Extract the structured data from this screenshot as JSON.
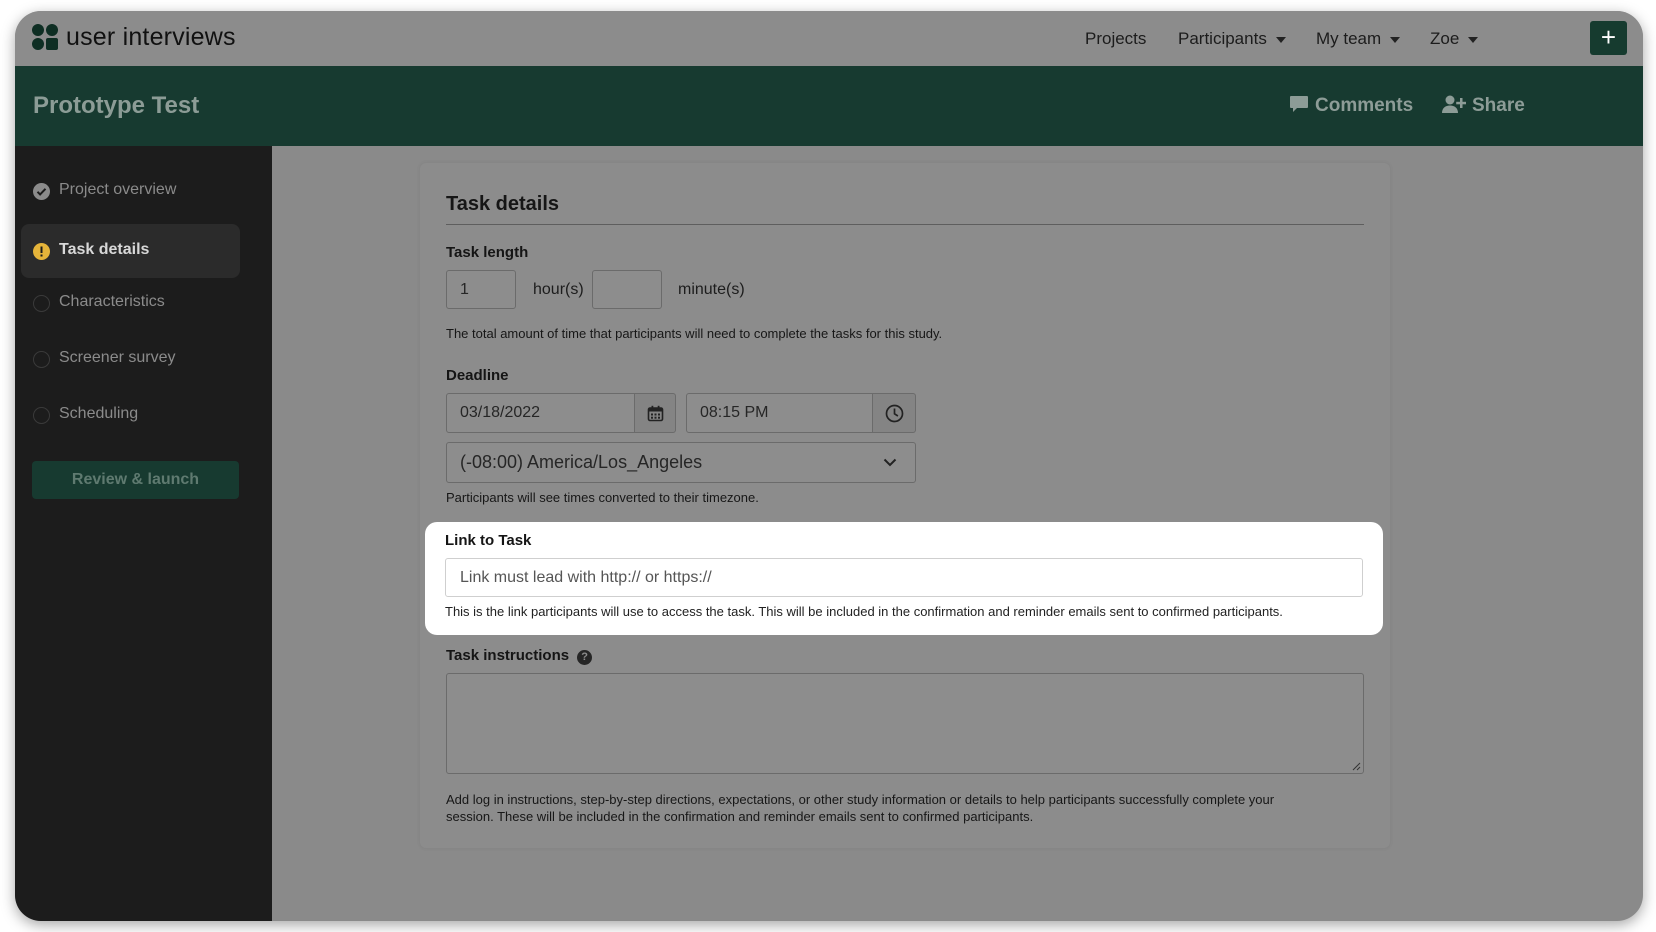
{
  "brand": {
    "name": "user interviews"
  },
  "topnav": {
    "items": [
      {
        "label": "Projects",
        "dropdown": false
      },
      {
        "label": "Participants",
        "dropdown": true
      },
      {
        "label": "My team",
        "dropdown": true
      },
      {
        "label": "Zoe",
        "dropdown": true
      }
    ],
    "plus_label": "+"
  },
  "project": {
    "title": "Prototype Test",
    "comments_label": "Comments",
    "share_label": "Share"
  },
  "sidebar": {
    "items": [
      {
        "label": "Project overview",
        "status": "complete"
      },
      {
        "label": "Task details",
        "status": "warning",
        "active": true
      },
      {
        "label": "Characteristics",
        "status": "empty"
      },
      {
        "label": "Screener survey",
        "status": "empty"
      },
      {
        "label": "Scheduling",
        "status": "empty"
      }
    ],
    "review_label": "Review & launch"
  },
  "task": {
    "section_title": "Task details",
    "length": {
      "label": "Task length",
      "hours_value": "1",
      "hours_unit": "hour(s)",
      "minutes_value": "",
      "minutes_unit": "minute(s)",
      "help": "The total amount of time that participants will need to complete the tasks for this study."
    },
    "deadline": {
      "label": "Deadline",
      "date": "03/18/2022",
      "time": "08:15 PM",
      "timezone": "(-08:00) America/Los_Angeles",
      "help": "Participants will see times converted to their timezone."
    },
    "link": {
      "label": "Link to Task",
      "placeholder": "Link must lead with http:// or https://",
      "help": "This is the link participants will use to access the task. This will be included in the confirmation and reminder emails sent to confirmed participants."
    },
    "instructions": {
      "label": "Task instructions",
      "help_mark": "?",
      "help_line1": "Add log in instructions, step-by-step directions, expectations, or other study information or details to help participants successfully complete your",
      "help_line2": "session. These will be included in the confirmation and reminder emails sent to confirmed participants."
    }
  },
  "colors": {
    "brand_dark": "#173a30",
    "sidebar_bg": "#1c1c1c",
    "warning": "#e5b43a",
    "overlay": "#8c8c8c"
  },
  "icons": [
    "logo-icon",
    "comment-icon",
    "add-user-icon",
    "check-circle-icon",
    "warning-icon",
    "calendar-icon",
    "clock-icon",
    "chevron-down-icon",
    "help-icon",
    "resize-grip-icon"
  ]
}
